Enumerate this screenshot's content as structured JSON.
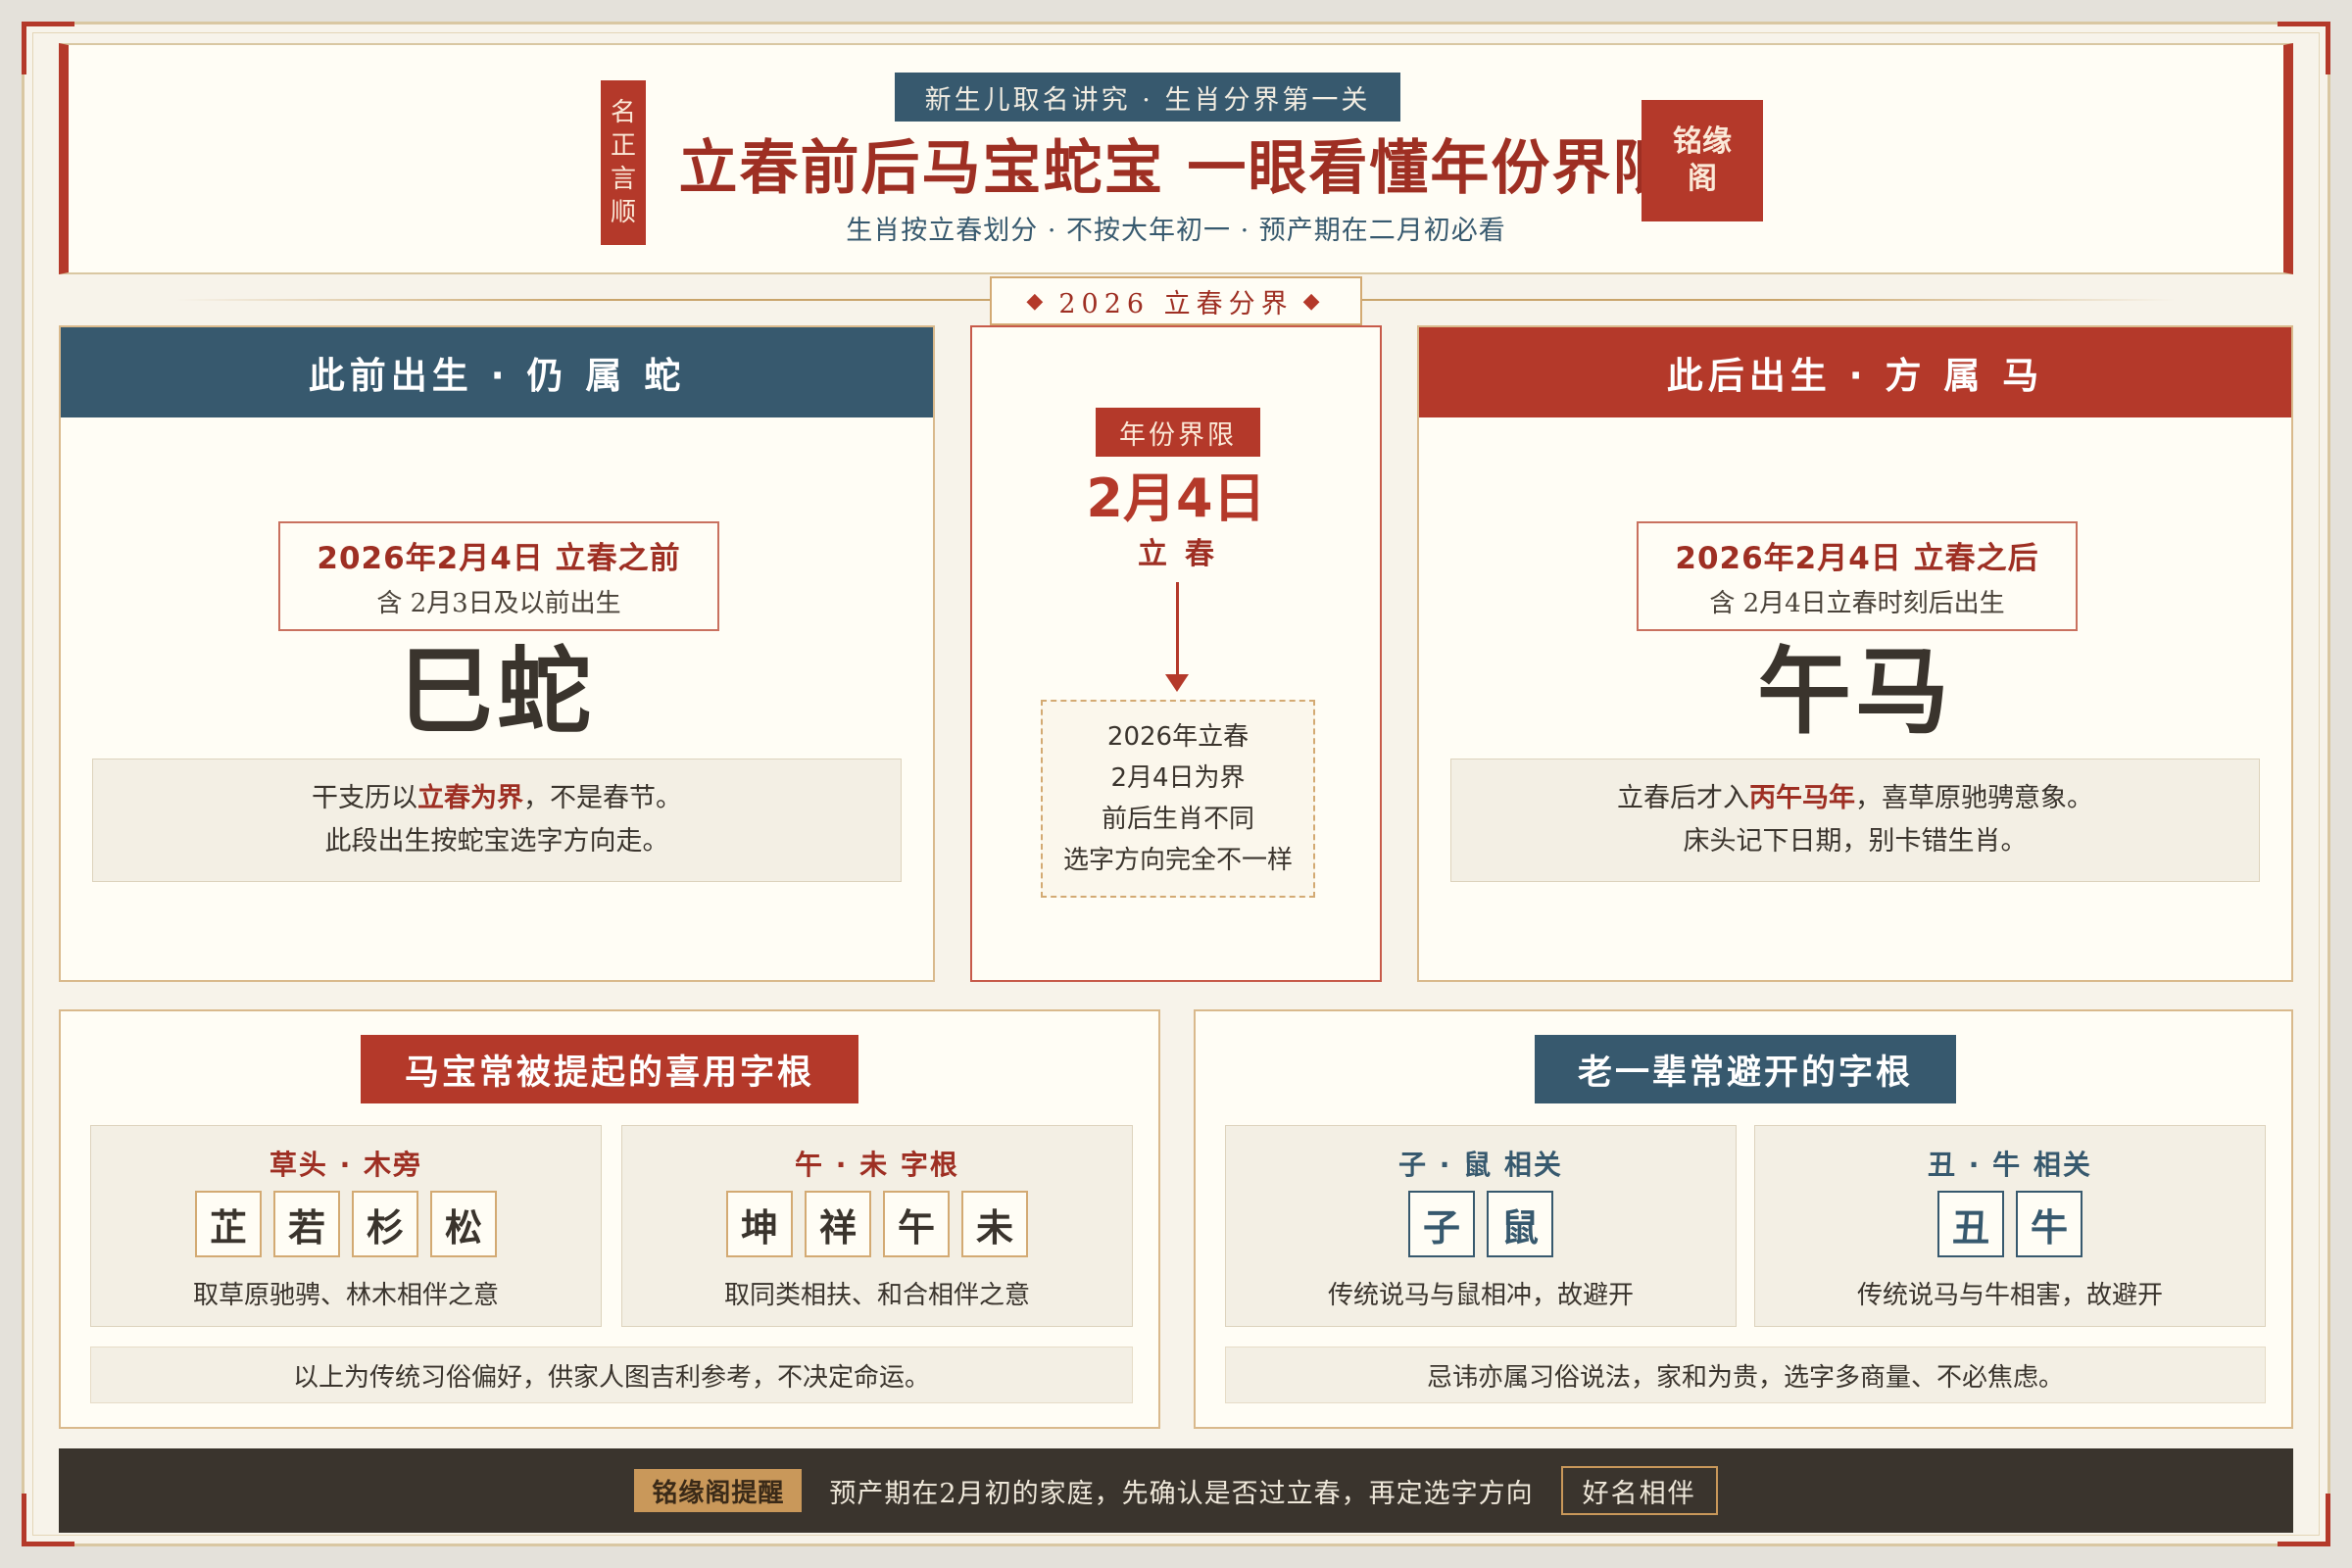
{
  "header": {
    "seal_vertical": [
      "名",
      "正",
      "言",
      "顺"
    ],
    "tag": "新生儿取名讲究 · 生肖分界第一关",
    "title": "立春前后马宝蛇宝 一眼看懂年份界限",
    "subtitle": "生肖按立春划分 · 不按大年初一 · 预产期在二月初必看",
    "seal_square": [
      "铭缘",
      "阁"
    ]
  },
  "divider": {
    "label": "2026 立春分界"
  },
  "left_card": {
    "heading": "此前出生 · 仍 属 蛇",
    "date_main": "2026年2月4日 立春之前",
    "date_sub": "含 2月3日及以前出生",
    "zodiac": "巳蛇",
    "note_line1_pre": "干支历以",
    "note_line1_hl": "立春为界",
    "note_line1_post": "，不是春节。",
    "note_line2": "此段出生按蛇宝选字方向走。"
  },
  "center_card": {
    "tag": "年份界限",
    "date": "2月4日",
    "solar_term": "立春",
    "lines": [
      "2026年立春",
      "2月4日为界",
      "前后生肖不同",
      "选字方向完全不一样"
    ]
  },
  "right_card": {
    "heading": "此后出生 · 方 属 马",
    "date_main": "2026年2月4日 立春之后",
    "date_sub": "含 2月4日立春时刻后出生",
    "zodiac": "午马",
    "note_line1_pre": "立春后才入",
    "note_line1_hl": "丙午马年",
    "note_line1_post": "，喜草原驰骋意象。",
    "note_line2": "床头记下日期，别卡错生肖。"
  },
  "favor_panel": {
    "title": "马宝常被提起的喜用字根",
    "groups": [
      {
        "title": "草头 · 木旁",
        "chars": [
          "芷",
          "若",
          "杉",
          "松"
        ],
        "desc": "取草原驰骋、林木相伴之意"
      },
      {
        "title": "午 · 未 字根",
        "chars": [
          "坤",
          "祥",
          "午",
          "未"
        ],
        "desc": "取同类相扶、和合相伴之意"
      }
    ],
    "note": "以上为传统习俗偏好，供家人图吉利参考，不决定命运。"
  },
  "avoid_panel": {
    "title": "老一辈常避开的字根",
    "groups": [
      {
        "title": "子 · 鼠 相关",
        "chars": [
          "子",
          "鼠"
        ],
        "desc": "传统说马与鼠相冲，故避开"
      },
      {
        "title": "丑 · 牛 相关",
        "chars": [
          "丑",
          "牛"
        ],
        "desc": "传统说马与牛相害，故避开"
      }
    ],
    "note": "忌讳亦属习俗说法，家和为贵，选字多商量、不必焦虑。"
  },
  "footer": {
    "tag": "铭缘阁提醒",
    "text": "预产期在2月初的家庭，先确认是否过立春，再定选字方向",
    "box": "好名相伴"
  },
  "colors": {
    "red": "#b4392a",
    "blue": "#37596e",
    "gold": "#c9985a",
    "dark": "#3a342d",
    "paper": "#fffdf5"
  }
}
